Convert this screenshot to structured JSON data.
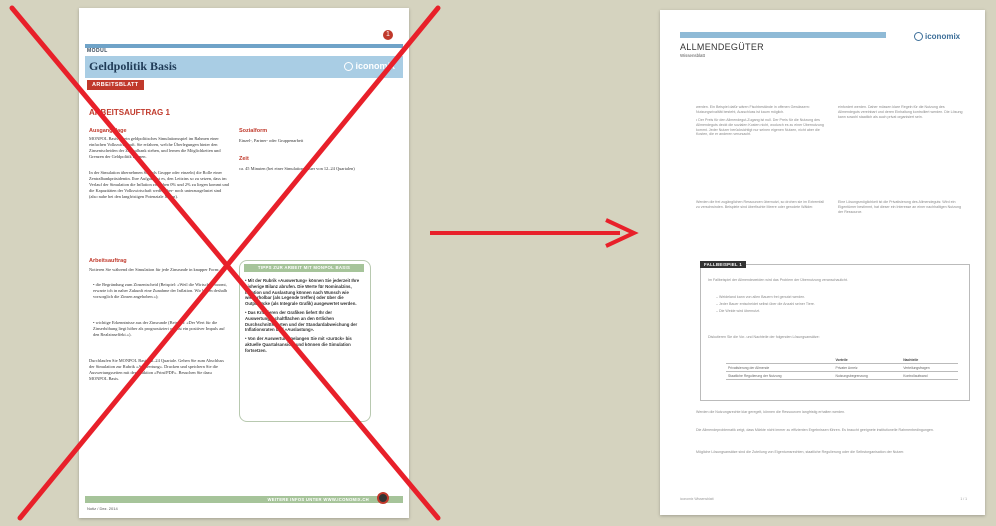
{
  "left_page": {
    "number_badge": "1",
    "module_label": "MODUL",
    "title": "Geldpolitik Basis",
    "logo_text": "iconomix",
    "tag": "ARBEITSBLATT",
    "section_title": "ARBEITSAUFTRAG 1",
    "ausgangslage_heading": "Ausgangslage",
    "ausgangslage_text": "MONPOL Basis ist ein geldpolitisches Simulationsspiel im Rahmen einer einfachen Volkswirtschaft. Sie erfahren, welche Überlegungen hinter den Zinsentscheiden der Zentralbank stehen, und lernen die Möglichkeiten und Grenzen der Geldpolitik kennen.",
    "ausgangslage_text2": "In der Simulation übernehmen Sie (als Gruppe oder einzeln) die Rolle einer Zentralbankpräsidentin. Ihre Aufgabe ist es, den Leitzins so zu setzen, dass im Verlauf der Simulation die Inflation zwischen 0% und 2% zu liegen kommt und die Kapazitäten der Volkswirtschaft weder über- noch unterausgelastet sind (also nahe bei den langfristigen Potenziale liegen).",
    "sozialform_heading": "Sozialform",
    "sozialform_text": "Einzel-, Partner- oder Gruppenarbeit",
    "zeit_heading": "Zeit",
    "zeit_text": "ca. 45 Minuten (bei einer Simulationsdauer von 12–24 Quartalen)",
    "arbeitsauftrag_heading": "Arbeitsauftrag",
    "arbeitsauftrag_text": "Notieren Sie während der Simulation für jede Zinsrunde in knapper Form:",
    "bullet1": "• die Begründung zum Zinsentscheid (Beispiel: «Weil die Wirtschaft boomt, erwarte ich in naher Zukunft eine Zunahme der Inflation. Wir haben deshalb vorsorglich die Zinsen angehoben.»);",
    "bullet2": "• wichtige Erkenntnisse aus der Zinsrunde (Beispiel: «Der Wert für die Zinserhöhung liegt höher als prognostiziert und ist ein positiver Impuls auf den Realzinseffekt.»).",
    "closing_text": "Durchlaufen Sie MONPOL Basis 12–24 Quartale. Gehen Sie zum Abschluss der Simulation zur Rubrik «Auswertung». Drucken und speichern Sie die Auswertungsseiten mit der Funktion «Print/PDF». Besuchen Sie dazu MONPOL Basis.",
    "tips_heading": "TIPPS ZUR ARBEIT MIT MONPOL BASIS",
    "tip1": "• Mit der Rubrik «Auswertung» können Sie jederzeit Ihre bisherige Bilanz abrufen. Die Werte für Nominalzins, Inflation und Auslastung können nach Wunsch wie wiederholbar (als Legende treffen) oder über die Outputlücke (als Integrale Grafik) ausgewertet werden.",
    "tip2": "• Das Kritisieren der Grafiken liefert Ihr der Auswertungsschaltflächen an den örtlichen Durchschnittswerten und der Standardabweichung der Inflationsraten und «Auslastung».",
    "tip3": "• Von der Auswertung gelangen Sie mit «zurück» bis aktuelle Quartalsansicht und können die Simulation fortsetzen.",
    "footer_text": "WEITERE INFOS UNTER WWW.ICONOMIX.CH",
    "footer_left": "Notiz / Dez. 2014"
  },
  "right_page": {
    "title": "ALLMENDEGÜTER",
    "subtitle": "Wissensblatt",
    "logo_text": "iconomix",
    "col1_a": "werden. Ein Beispiel dafür wären Fischbestände in offenen Gewässern: Nutzungsrivalität besteht, Ausschluss ist kaum möglich.",
    "col1_b": "• Der Preis für den Allmendegut-Zugang ist null. Der Preis für die Nutzung des Allmendeguts deckt die sozialen Kosten nicht, wodurch es zu einer Übernutzung kommt. Jeder Nutzer berücksichtigt nur seinen eigenen Nutzen, nicht aber die Kosten, die er anderen verursacht.",
    "col1_c": "Werden die frei zugänglichen Ressourcen übernutzt, so drohen sie im Extremfall zu verschwinden. Beispiele sind überfischte Meere oder gerodete Wälder.",
    "col2_a": "einfordert werden. Daher müssen klare Regeln für die Nutzung des Allmendeguts vereinbart und deren Einhaltung kontrolliert werden. Die Lösung kann sowohl staatlich als auch privat organisiert sein.",
    "col2_b": "Eine Lösungsmöglichkeit ist die Privatisierung des Allmendeguts: Wird ein Eigentümer bestimmt, hat dieser ein Interesse an einer nachhaltigen Nutzung der Ressource.",
    "box_tag": "FALLBEISPIEL 1",
    "box_text1": "Im Fallbeispiel der Allmendeweiden wird das Problem der Übernutzung veranschaulicht.",
    "box_bullet1": "– Weideland kann von allen Bauern frei genutzt werden.",
    "box_bullet2": "– Jeder Bauer entscheidet selbst über die Anzahl seiner Tiere.",
    "box_bullet3": "– Die Weide wird übernutzt.",
    "box_question": "Diskutieren Sie die Vor- und Nachteile der folgenden Lösungsansätze:",
    "table_headers": [
      "",
      "Vorteile",
      "Nachteile"
    ],
    "table_rows": [
      [
        "Privatisierung der Allmende",
        "Privater Anreiz",
        "Verteilungsfragen"
      ],
      [
        "Staatliche Regulierung der Nutzung",
        "Nutzungsbegrenzung",
        "Kontrollaufwand"
      ]
    ],
    "bottom_text1": "Werden die Nutzungsrechte klar geregelt, können die Ressourcen langfristig erhalten werden.",
    "bottom_text2": "Die Allmendeproblematik zeigt, dass Märkte nicht immer zu effizienten Ergebnissen führen. Es braucht geeignete institutionelle Rahmenbedingungen.",
    "bottom_text3": "Mögliche Lösungsansätze sind die Zuteilung von Eigentumsrechten, staatliche Regulierung oder die Selbstorganisation der Nutzer.",
    "footer_left": "iconomix Wissensblatt",
    "footer_right": "1 / 1"
  },
  "colors": {
    "background": "#d5d3bf",
    "cross": "#e8202a",
    "arrow": "#e8202a",
    "accent_red": "#c0392b",
    "header_blue": "#a9cde4"
  }
}
